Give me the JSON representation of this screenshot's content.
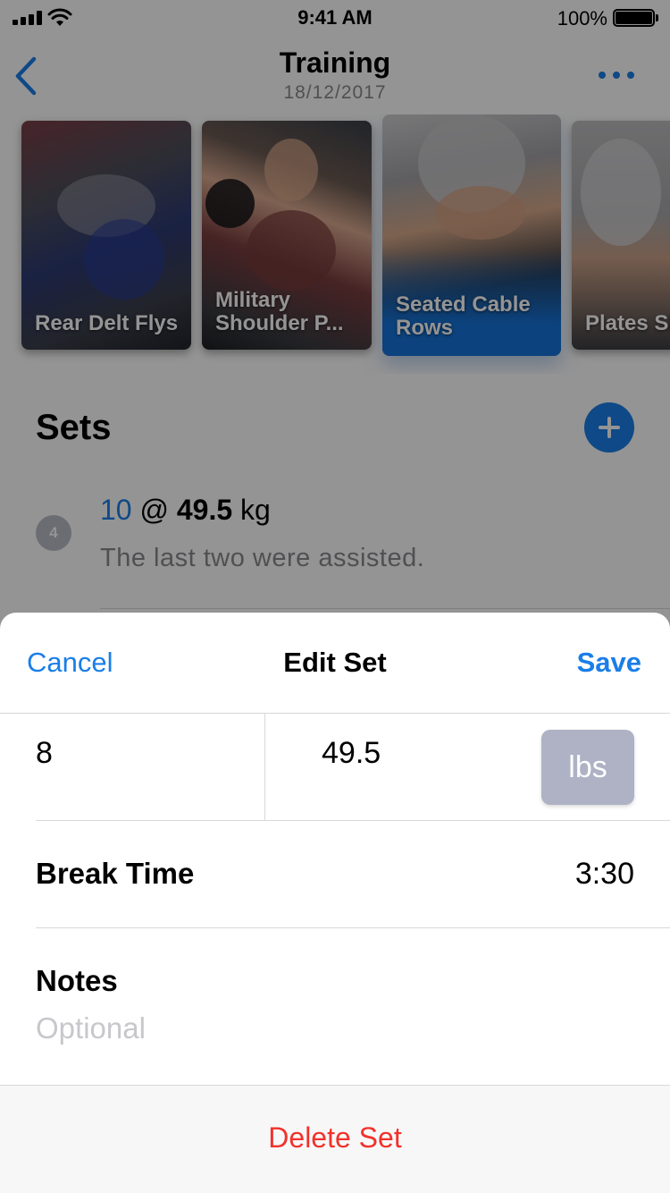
{
  "status_bar": {
    "time": "9:41 AM",
    "battery_percent": "100%"
  },
  "nav": {
    "title": "Training",
    "date": "18/12/2017",
    "back_icon": "chevron-left-icon",
    "more_icon": "ellipsis-icon"
  },
  "exercises": [
    {
      "label": "Rear Delt Flys",
      "selected": false
    },
    {
      "label": "Military Shoulder P...",
      "selected": false
    },
    {
      "label": "Seated Cable Rows",
      "selected": true
    },
    {
      "label": "Plates Shrugs",
      "selected": false
    }
  ],
  "sets": {
    "heading": "Sets",
    "add_icon": "plus-icon",
    "items": [
      {
        "number": "4",
        "reps": "10",
        "at": "@",
        "weight": "49.5",
        "unit": "kg",
        "note": "The last two were assisted."
      }
    ]
  },
  "sheet": {
    "cancel_label": "Cancel",
    "title": "Edit Set",
    "save_label": "Save",
    "reps_value": "8",
    "weight_value": "49.5",
    "unit_label": "lbs",
    "break_label": "Break Time",
    "break_value": "3:30",
    "notes_label": "Notes",
    "notes_placeholder": "Optional",
    "delete_label": "Delete Set"
  },
  "colors": {
    "accent": "#1a7ee8",
    "destructive": "#f2322b",
    "unit_toggle": "#aeb2c4",
    "overlay": "rgba(0,0,0,0.42)"
  }
}
